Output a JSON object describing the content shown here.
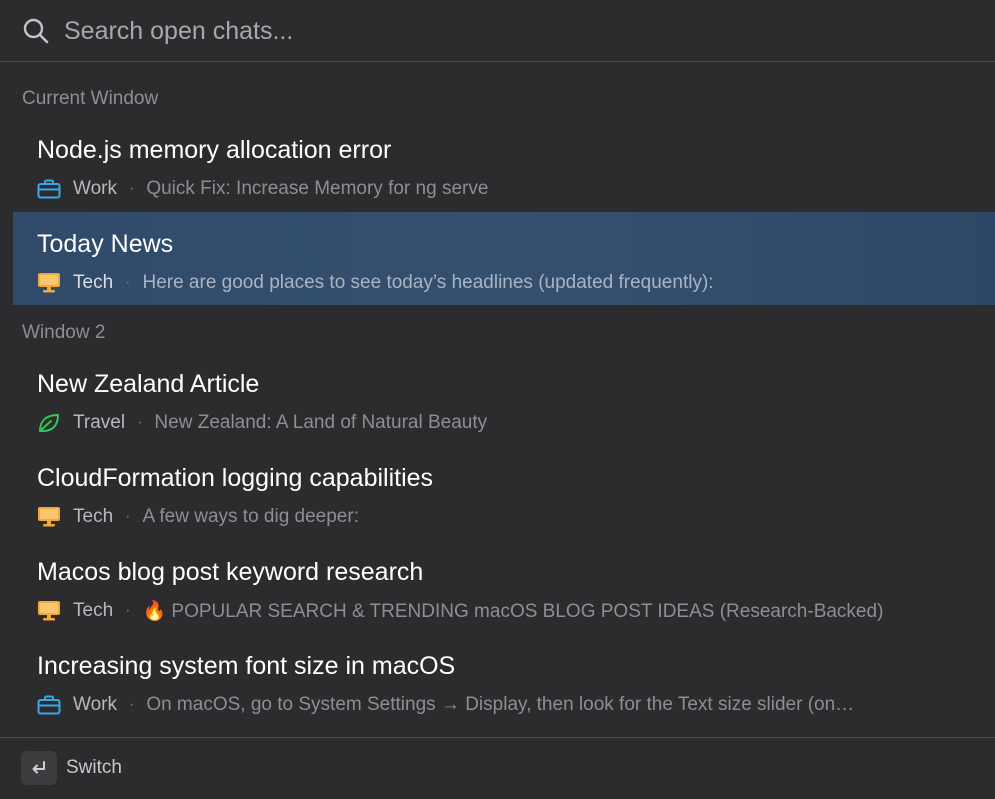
{
  "search": {
    "placeholder": "Search open chats...",
    "value": ""
  },
  "groups": [
    {
      "header": "Current Window",
      "items": [
        {
          "title": "Node.js memory allocation error",
          "tag": "Work",
          "tag_icon": "briefcase-icon",
          "preview": "Quick Fix: Increase Memory for ng serve",
          "selected": false
        },
        {
          "title": "Today News",
          "tag": "Tech",
          "tag_icon": "monitor-icon",
          "preview": "Here are good places to see today’s headlines (updated frequently):",
          "selected": true
        }
      ]
    },
    {
      "header": "Window 2",
      "items": [
        {
          "title": "New Zealand Article",
          "tag": "Travel",
          "tag_icon": "leaf-icon",
          "preview": "New Zealand: A Land of Natural Beauty",
          "selected": false
        },
        {
          "title": "CloudFormation logging capabilities",
          "tag": "Tech",
          "tag_icon": "monitor-icon",
          "preview": "A few ways to dig deeper:",
          "selected": false
        },
        {
          "title": "Macos blog post keyword research",
          "tag": "Tech",
          "tag_icon": "monitor-icon",
          "preview": "🔥 POPULAR SEARCH & TRENDING macOS BLOG POST IDEAS (Research-Backed)",
          "selected": false
        },
        {
          "title": "Increasing system font size in macOS",
          "tag": "Work",
          "tag_icon": "briefcase-icon",
          "preview": "On macOS, go to System Settings → Display, then look for the Text size slider (on…",
          "selected": false
        }
      ]
    }
  ],
  "separator": "·",
  "footer": {
    "key_icon": "return-key-icon",
    "label": "Switch"
  },
  "colors": {
    "background": "#2c2c2e",
    "selected_row": "#33506f",
    "work_tag": "#3ba7e8",
    "tech_tag": "#f2a93b",
    "travel_tag": "#34c759"
  }
}
